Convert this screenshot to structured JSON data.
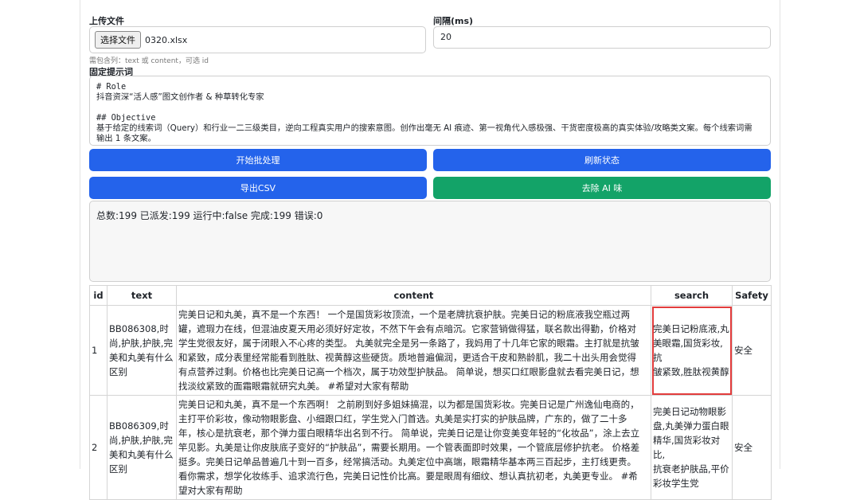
{
  "form": {
    "upload_label": "上传文件",
    "choose_file_button": "选择文件",
    "file_name": "0320.xlsx",
    "interval_label": "间隔(ms)",
    "interval_value": "20",
    "hint": "需包含列：text 或 content，可选 id",
    "prompt_label": "固定提示词",
    "prompt_lines": [
      "# Role",
      "抖音资深“活人感”图文创作者 & 种草转化专家",
      "",
      "## Objective",
      "基于给定的线索词（Query）和行业一二三级类目，逆向工程真实用户的搜索意图。创作出毫无 AI 痕迹、第一视角代入感极强、干货密度极高的真实体验/攻略类文案。每个线索词需",
      "输出 1 条文案。"
    ]
  },
  "buttons": {
    "start": "开始批处理",
    "refresh": "刷新状态",
    "export": "导出CSV",
    "remove_ai": "去除 AI 味"
  },
  "status": "总数:199 已派发:199 运行中:false 完成:199 错误:0",
  "table": {
    "headers": [
      "id",
      "text",
      "content",
      "search",
      "Safety"
    ],
    "rows": [
      {
        "id": "1",
        "text": "BB086308,时\n尚,护肤,护肤,完\n美和丸美有什么\n区别",
        "content": "完美日记和丸美，真不是一个东西！ 一个是国货彩妆顶流，一个是老牌抗衰护肤。完美日记的粉底液我空瓶过两\n罐，遮瑕力在线，但混油皮夏天用必须好好定妆，不然下午会有点暗沉。它家营销做得猛，联名款出得勤，价格对\n学生党很友好，属于闭眼入不心疼的类型。 丸美就完全是另一条路了，我妈用了十几年它家的眼霜。主打就是抗皱\n和紧致，成分表里经常能看到胜肽、视黄醇这些硬货。质地普遍偏润，更适合干皮和熟龄肌，我二十出头用会觉得\n有点营养过剩。价格也比完美日记高一个档次，属于功效型护肤品。 简单说，想买口红眼影盘就去看完美日记，想\n找淡纹紧致的面霜眼霜就研究丸美。 #希望对大家有帮助",
        "search": "完美日记粉底液,丸\n美眼霜,国货彩妆,抗\n皱紧致,胜肽视黄醇",
        "safety": "安全"
      },
      {
        "id": "2",
        "text": "BB086309,时\n尚,护肤,护肤,完\n美和丸美有什么\n区别",
        "content": "完美日记和丸美，真不是一个东西啊！ 之前刷到好多姐妹搞混，以为都是国货彩妆。完美日记是广州逸仙电商的，\n主打平价彩妆，像动物眼影盘、小细跟口红，学生党入门首选。丸美是实打实的护肤品牌，广东的，做了二十多\n年，核心是抗衰老，那个弹力蛋白眼精华出名到不行。 简单说，完美日记是让你变美变年轻的“化妆品”，涂上去立\n竿见影。丸美是让你皮肤底子变好的“护肤品”，需要长期用。一个管表面即时效果，一个管底层修护抗老。 价格差\n挺多。完美日记单品普遍几十到一百多，经常搞活动。丸美定位中高端，眼霜精华基本两三百起步，主打线更贵。\n看你需求，想学化妆练手、追求流行色，完美日记性价比高。要是眼周有细纹、想认真抗初老，丸美更专业。 #希\n望对大家有帮助",
        "search": "完美日记动物眼影\n盘,丸美弹力蛋白眼\n精华,国货彩妆对比,\n抗衰老护肤品,平价\n彩妆学生党",
        "safety": "安全"
      }
    ]
  },
  "colors": {
    "primary": "#2463eb",
    "success": "#13a368",
    "highlight": "#e23c3c"
  }
}
